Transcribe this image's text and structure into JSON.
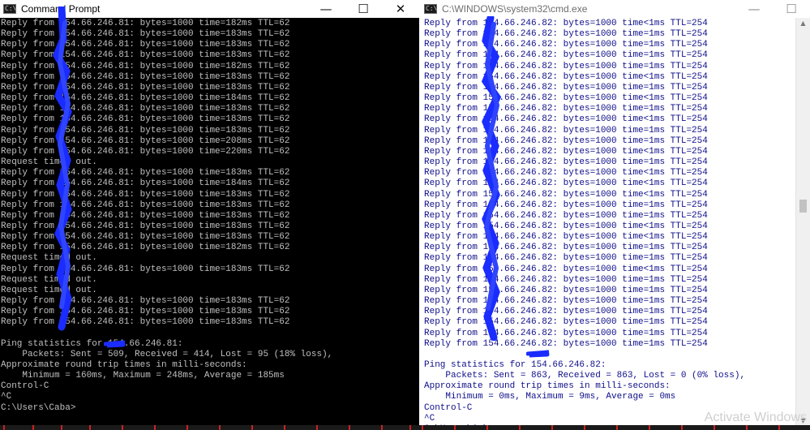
{
  "left_window": {
    "title": "Command Prompt",
    "icon_text": "C:\\",
    "controls": {
      "minimize": "—",
      "maximize": "☐",
      "close": "✕"
    },
    "lines": [
      "Reply from 154.66.246.81: bytes=1000 time=182ms TTL=62",
      "Reply from 154.66.246.81: bytes=1000 time=183ms TTL=62",
      "Reply from 154.66.246.81: bytes=1000 time=183ms TTL=62",
      "Reply from 154.66.246.81: bytes=1000 time=183ms TTL=62",
      "Reply from 154.66.246.81: bytes=1000 time=182ms TTL=62",
      "Reply from 154.66.246.81: bytes=1000 time=183ms TTL=62",
      "Reply from 154.66.246.81: bytes=1000 time=183ms TTL=62",
      "Reply from 154.66.246.81: bytes=1000 time=184ms TTL=62",
      "Reply from 154.66.246.81: bytes=1000 time=183ms TTL=62",
      "Reply from 154.66.246.81: bytes=1000 time=183ms TTL=62",
      "Reply from 154.66.246.81: bytes=1000 time=183ms TTL=62",
      "Reply from 154.66.246.81: bytes=1000 time=208ms TTL=62",
      "Reply from 154.66.246.81: bytes=1000 time=220ms TTL=62",
      "Request timed out.",
      "Reply from 154.66.246.81: bytes=1000 time=183ms TTL=62",
      "Reply from 154.66.246.81: bytes=1000 time=184ms TTL=62",
      "Reply from 154.66.246.81: bytes=1000 time=183ms TTL=62",
      "Reply from 154.66.246.81: bytes=1000 time=183ms TTL=62",
      "Reply from 154.66.246.81: bytes=1000 time=183ms TTL=62",
      "Reply from 154.66.246.81: bytes=1000 time=183ms TTL=62",
      "Reply from 154.66.246.81: bytes=1000 time=183ms TTL=62",
      "Reply from 154.66.246.81: bytes=1000 time=182ms TTL=62",
      "Request timed out.",
      "Reply from 154.66.246.81: bytes=1000 time=183ms TTL=62",
      "Request timed out.",
      "Request timed out.",
      "Reply from 154.66.246.81: bytes=1000 time=183ms TTL=62",
      "Reply from 154.66.246.81: bytes=1000 time=183ms TTL=62",
      "Reply from 154.66.246.81: bytes=1000 time=183ms TTL=62",
      "",
      "Ping statistics for 154.66.246.81:",
      "    Packets: Sent = 509, Received = 414, Lost = 95 (18% loss),",
      "Approximate round trip times in milli-seconds:",
      "    Minimum = 160ms, Maximum = 248ms, Average = 185ms",
      "Control-C",
      "^C",
      "C:\\Users\\Caba>"
    ]
  },
  "right_window": {
    "title": "C:\\WINDOWS\\system32\\cmd.exe",
    "icon_text": "C:\\",
    "controls": {
      "minimize": "—",
      "maximize": "☐",
      "close": "✕"
    },
    "scroll_up": "▲",
    "scroll_down": "▼",
    "lines": [
      "Reply from 154.66.246.82: bytes=1000 time<1ms TTL=254",
      "Reply from 154.66.246.82: bytes=1000 time=1ms TTL=254",
      "Reply from 154.66.246.82: bytes=1000 time=1ms TTL=254",
      "Reply from 154.66.246.82: bytes=1000 time=1ms TTL=254",
      "Reply from 154.66.246.82: bytes=1000 time=1ms TTL=254",
      "Reply from 154.66.246.82: bytes=1000 time<1ms TTL=254",
      "Reply from 154.66.246.82: bytes=1000 time=1ms TTL=254",
      "Reply from 154.66.246.82: bytes=1000 time<1ms TTL=254",
      "Reply from 154.66.246.82: bytes=1000 time=1ms TTL=254",
      "Reply from 154.66.246.82: bytes=1000 time<1ms TTL=254",
      "Reply from 154.66.246.82: bytes=1000 time=1ms TTL=254",
      "Reply from 154.66.246.82: bytes=1000 time=1ms TTL=254",
      "Reply from 154.66.246.82: bytes=1000 time<1ms TTL=254",
      "Reply from 154.66.246.82: bytes=1000 time=1ms TTL=254",
      "Reply from 154.66.246.82: bytes=1000 time<1ms TTL=254",
      "Reply from 154.66.246.82: bytes=1000 time<1ms TTL=254",
      "Reply from 154.66.246.82: bytes=1000 time<1ms TTL=254",
      "Reply from 154.66.246.82: bytes=1000 time=1ms TTL=254",
      "Reply from 154.66.246.82: bytes=1000 time=1ms TTL=254",
      "Reply from 154.66.246.82: bytes=1000 time<1ms TTL=254",
      "Reply from 154.66.246.82: bytes=1000 time<1ms TTL=254",
      "Reply from 154.66.246.82: bytes=1000 time=1ms TTL=254",
      "Reply from 154.66.246.82: bytes=1000 time=1ms TTL=254",
      "Reply from 154.66.246.82: bytes=1000 time<1ms TTL=254",
      "Reply from 154.66.246.82: bytes=1000 time=1ms TTL=254",
      "Reply from 154.66.246.82: bytes=1000 time=1ms TTL=254",
      "Reply from 154.66.246.82: bytes=1000 time=1ms TTL=254",
      "Reply from 154.66.246.82: bytes=1000 time=1ms TTL=254",
      "Reply from 154.66.246.82: bytes=1000 time=1ms TTL=254",
      "Reply from 154.66.246.82: bytes=1000 time=1ms TTL=254",
      "Reply from 154.66.246.82: bytes=1000 time=1ms TTL=254",
      "",
      "Ping statistics for 154.66.246.82:",
      "    Packets: Sent = 863, Received = 863, Lost = 0 (0% loss),",
      "Approximate round trip times in milli-seconds:",
      "    Minimum = 0ms, Maximum = 9ms, Average = 0ms",
      "Control-C",
      "^C",
      "C:\\Users\\Caba>"
    ]
  },
  "watermark": "Activate Windows",
  "colors": {
    "left_console_bg": "#000000",
    "left_console_fg": "#c0c0c0",
    "right_console_bg": "#ffffff",
    "right_console_fg": "#0e0e8a",
    "redaction": "#1a2cff"
  }
}
